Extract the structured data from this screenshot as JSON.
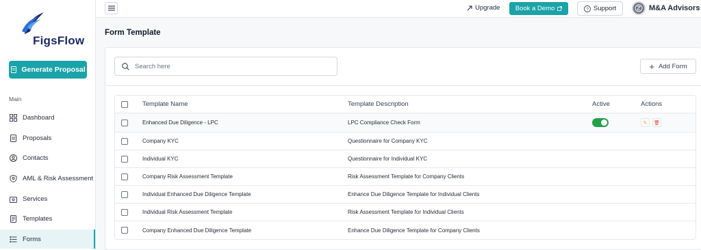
{
  "brand": {
    "name": "FigsFlow"
  },
  "sidebar": {
    "generate_label": "Generate Proposal",
    "section_label": "Main",
    "items": [
      {
        "label": "Dashboard",
        "icon": "grid-icon"
      },
      {
        "label": "Proposals",
        "icon": "document-icon"
      },
      {
        "label": "Contacts",
        "icon": "contact-icon"
      },
      {
        "label": "AML & Risk Assessment",
        "icon": "shield-icon"
      },
      {
        "label": "Services",
        "icon": "briefcase-icon"
      },
      {
        "label": "Templates",
        "icon": "template-icon"
      },
      {
        "label": "Forms",
        "icon": "list-icon",
        "active": true
      }
    ]
  },
  "topbar": {
    "upgrade_label": "Upgrade",
    "demo_label": "Book a Demo",
    "support_label": "Support",
    "org_name": "M&A Advisors"
  },
  "page": {
    "title": "Form Template",
    "search_placeholder": "Search here",
    "add_label": "Add Form"
  },
  "table": {
    "headers": {
      "name": "Template Name",
      "description": "Template Description",
      "active": "Active",
      "actions": "Actions"
    },
    "rows": [
      {
        "name": "Enhanced Due Diligence - LPC",
        "description": "LPC Compliance Check Form",
        "active": true
      },
      {
        "name": "Company KYC",
        "description": "Questionnaire for Company KYC"
      },
      {
        "name": "Individual KYC",
        "description": "Questionnaire for Individual KYC"
      },
      {
        "name": "Company Risk Assessment Template",
        "description": "Risk Assessment Template for Company Clients"
      },
      {
        "name": "Individual Enhanced Due Diligence Template",
        "description": "Enhance Due Diligence Template for Individual Clients"
      },
      {
        "name": "Individual Risk Assessment Template",
        "description": "Risk Assessment Template for Individual Clients"
      },
      {
        "name": "Company Enhanced Due Diligence Template",
        "description": "Enhance Due Diligence Template for Company Clients"
      }
    ]
  },
  "colors": {
    "accent": "#1aa3a8",
    "brand_dark": "#1b2a6b",
    "toggle_on": "#22a348"
  }
}
